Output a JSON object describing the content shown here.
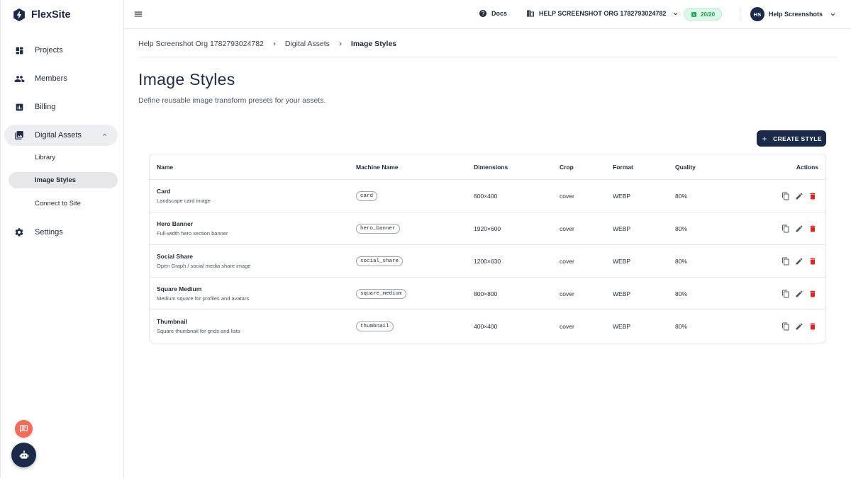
{
  "brand": {
    "name": "FlexSite"
  },
  "sidebar": {
    "items": [
      {
        "label": "Projects",
        "icon": "dashboard-icon"
      },
      {
        "label": "Members",
        "icon": "people-icon"
      },
      {
        "label": "Billing",
        "icon": "bar-chart-icon"
      },
      {
        "label": "Digital Assets",
        "icon": "image-library-icon",
        "expanded": true
      },
      {
        "label": "Settings",
        "icon": "gear-icon"
      }
    ],
    "subitems": [
      {
        "label": "Library"
      },
      {
        "label": "Image Styles",
        "active": true
      },
      {
        "label": "Connect to Site"
      }
    ]
  },
  "topbar": {
    "docs_label": "Docs",
    "org_label": "HELP SCREENSHOT ORG 1782793024782",
    "quota_label": "20/20",
    "user_initials": "HS",
    "user_name": "Help Screenshots"
  },
  "breadcrumb": {
    "items": [
      "Help Screenshot Org 1782793024782",
      "Digital Assets",
      "Image Styles"
    ]
  },
  "page": {
    "title": "Image Styles",
    "subtitle": "Define reusable image transform presets for your assets.",
    "create_label": "CREATE STYLE"
  },
  "table": {
    "headers": {
      "name": "Name",
      "machine": "Machine Name",
      "dimensions": "Dimensions",
      "crop": "Crop",
      "format": "Format",
      "quality": "Quality",
      "actions": "Actions"
    },
    "rows": [
      {
        "name": "Card",
        "desc": "Landscape card image",
        "machine": "card",
        "dimensions": "600×400",
        "crop": "cover",
        "format": "WEBP",
        "quality": "80%"
      },
      {
        "name": "Hero Banner",
        "desc": "Full-width hero section banner",
        "machine": "hero_banner",
        "dimensions": "1920×600",
        "crop": "cover",
        "format": "WEBP",
        "quality": "80%"
      },
      {
        "name": "Social Share",
        "desc": "Open Graph / social media share image",
        "machine": "social_share",
        "dimensions": "1200×630",
        "crop": "cover",
        "format": "WEBP",
        "quality": "80%"
      },
      {
        "name": "Square Medium",
        "desc": "Medium square for profiles and avatars",
        "machine": "square_medium",
        "dimensions": "800×800",
        "crop": "cover",
        "format": "WEBP",
        "quality": "80%"
      },
      {
        "name": "Thumbnail",
        "desc": "Square thumbnail for grids and lists",
        "machine": "thumbnail",
        "dimensions": "400×400",
        "crop": "cover",
        "format": "WEBP",
        "quality": "80%"
      }
    ]
  },
  "colors": {
    "navy": "#1b2a48",
    "delete_red": "#dc2626",
    "quota_green": "#16a34a",
    "feedback_coral": "#f26b5b"
  }
}
